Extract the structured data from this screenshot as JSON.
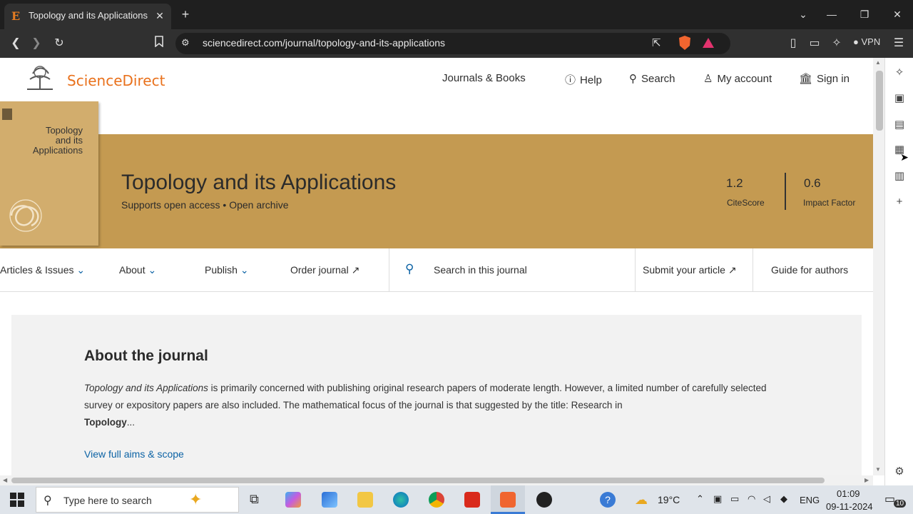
{
  "browser": {
    "tab_title": "Topology and its Applications |",
    "tab_favicon": "E",
    "url": "sciencedirect.com/journal/topology-and-its-applications",
    "vpn_label": "VPN"
  },
  "site": {
    "logo": "ScienceDirect",
    "nav": {
      "journals": "Journals & Books",
      "help": "Help",
      "search": "Search",
      "account": "My account",
      "signin": "Sign in"
    }
  },
  "journal": {
    "cover_title": [
      "Topology",
      "and its",
      "Applications"
    ],
    "title": "Topology and its Applications",
    "subtitle": "Supports open access • Open archive",
    "citescore_value": "1.2",
    "citescore_label": "CiteScore",
    "impact_value": "0.6",
    "impact_label": "Impact Factor"
  },
  "journal_nav": {
    "articles": "Articles & Issues",
    "about": "About",
    "publish": "Publish",
    "order": "Order journal ↗",
    "search_placeholder": "Search in this journal",
    "submit": "Submit your article ↗",
    "guide": "Guide for authors"
  },
  "about": {
    "heading": "About the journal",
    "journal_name": "Topology and its Applications",
    "body": " is primarily concerned with publishing original research papers of moderate length. However, a limited number of carefully selected survey or expository papers are also included. The mathematical focus of the journal is that suggested by the title: Research in",
    "body_bold": "Topology",
    "body_end": "...",
    "link": "View full aims & scope"
  },
  "taskbar": {
    "search_placeholder": "Type here to search",
    "weather": "19°C",
    "language": "ENG",
    "time": "01:09",
    "date": "09-11-2024",
    "notifications": "10"
  },
  "colors": {
    "brand_orange": "#e9711c",
    "band": "#c49a51",
    "link": "#0c63a5"
  }
}
